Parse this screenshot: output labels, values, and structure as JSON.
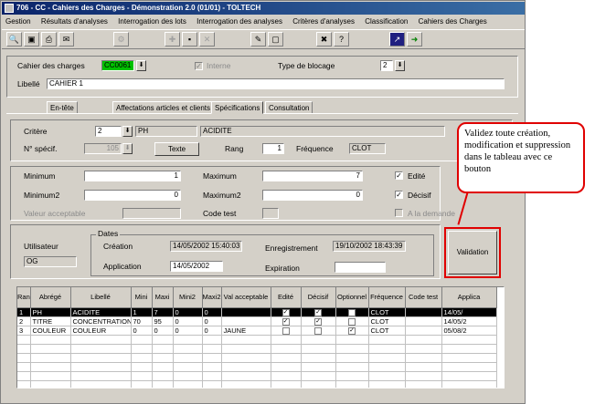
{
  "window": {
    "title": "706 - CC - Cahiers des Charges - Démonstration 2.0 (01/01) - TOLTECH"
  },
  "menu": [
    "Gestion",
    "Résultats d'analyses",
    "Interrogation des lots",
    "Interrogation des analyses",
    "Critères d'analyses",
    "Classification",
    "Cahiers des Charges"
  ],
  "header": {
    "cahier_label": "Cahier des charges",
    "cahier_value": "CC0061",
    "interne_label": "Interne",
    "type_blocage_label": "Type de blocage",
    "type_blocage_value": "2",
    "libelle_label": "Libellé",
    "libelle_value": "CAHIER 1"
  },
  "tabs": [
    "En-tête",
    "Affectations articles et clients",
    "Spécifications",
    "Consultation"
  ],
  "spec": {
    "critere_label": "Critère",
    "critere_num": "2",
    "critere_code": "PH",
    "critere_name": "ACIDITE",
    "num_specif_label": "N° spécif.",
    "num_specif_value": "105",
    "texte_button": "Texte",
    "rang_label": "Rang",
    "rang_value": "1",
    "frequence_label": "Fréquence",
    "frequence_value": "CLOT"
  },
  "limits": {
    "minimum_label": "Minimum",
    "minimum_value": "1",
    "maximum_label": "Maximum",
    "maximum_value": "7",
    "edite_label": "Edité",
    "minimum2_label": "Minimum2",
    "minimum2_value": "0",
    "maximum2_label": "Maximum2",
    "maximum2_value": "0",
    "decisif_label": "Décisif",
    "valeur_label": "Valeur acceptable",
    "code_test_label": "Code test",
    "a_la_demande_label": "A la demande"
  },
  "dates": {
    "group_label": "Dates",
    "utilisateur_label": "Utilisateur",
    "utilisateur_value": "OG",
    "creation_label": "Création",
    "creation_value": "14/05/2002 15:40:03",
    "enregistrement_label": "Enregistrement",
    "enregistrement_value": "19/10/2002 18:43:39",
    "application_label": "Application",
    "application_value": "14/05/2002",
    "expiration_label": "Expiration",
    "expiration_value": ""
  },
  "validation_button": "Validation",
  "grid": {
    "columns": [
      "Rang",
      "Abrégé",
      "Libellé",
      "Mini",
      "Maxi",
      "Mini2",
      "Maxi2",
      "Val acceptable",
      "Edité",
      "Décisif",
      "Optionnel",
      "Fréquence",
      "Code test",
      "Applica"
    ],
    "rows": [
      {
        "rang": "1",
        "abrege": "PH",
        "libelle": "ACIDITE",
        "mini": "1",
        "maxi": "7",
        "mini2": "0",
        "maxi2": "0",
        "val": "",
        "edite": true,
        "decisif": true,
        "optionnel": false,
        "freq": "CLOT",
        "code": "",
        "appli": "14/05/"
      },
      {
        "rang": "2",
        "abrege": "TITRE",
        "libelle": "CONCENTRATION",
        "mini": "70",
        "maxi": "95",
        "mini2": "0",
        "maxi2": "0",
        "val": "",
        "edite": true,
        "decisif": true,
        "optionnel": false,
        "freq": "CLOT",
        "code": "",
        "appli": "14/05/2"
      },
      {
        "rang": "3",
        "abrege": "COULEUR",
        "libelle": "COULEUR",
        "mini": "0",
        "maxi": "0",
        "mini2": "0",
        "maxi2": "0",
        "val": "JAUNE",
        "edite": false,
        "decisif": false,
        "optionnel": true,
        "freq": "CLOT",
        "code": "",
        "appli": "05/08/2"
      }
    ]
  },
  "callout": {
    "text": "Validez toute création, modification et suppression dans le tableau avec ce bouton"
  }
}
